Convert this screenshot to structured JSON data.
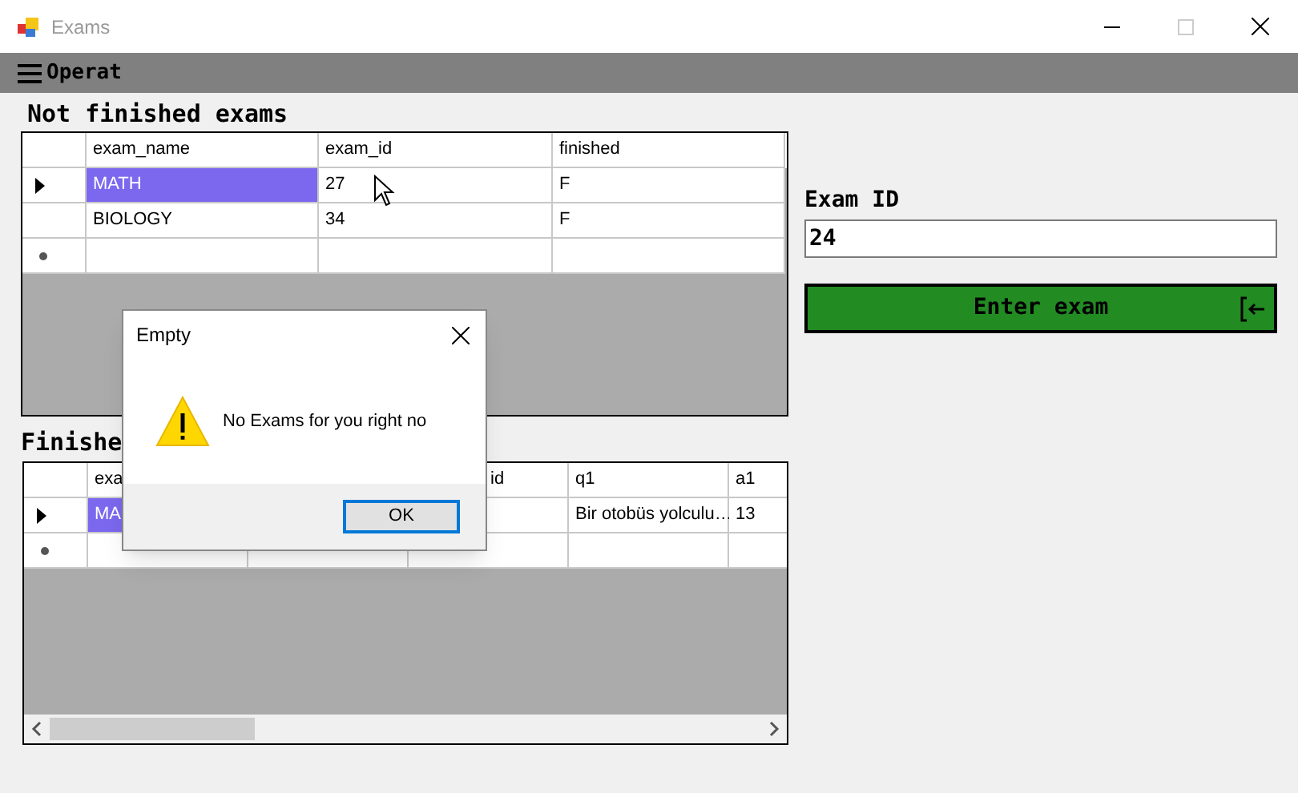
{
  "window": {
    "title": "Exams"
  },
  "menu": [
    {
      "label": "Operat"
    }
  ],
  "not_finished": {
    "title": "Not finished exams",
    "columns": [
      {
        "label": "exam_name"
      },
      {
        "label": "exam_id"
      },
      {
        "label": "finished"
      }
    ],
    "rows": [
      {
        "current": true,
        "cells": [
          {
            "text": "MATH",
            "selected": true
          },
          {
            "text": "27",
            "selected": false
          },
          {
            "text": "F",
            "selected": false
          }
        ]
      },
      {
        "current": false,
        "cells": [
          {
            "text": "BIOLOGY",
            "selected": false
          },
          {
            "text": "34",
            "selected": false
          },
          {
            "text": "F",
            "selected": false
          }
        ]
      }
    ]
  },
  "finished": {
    "title": "Finishe",
    "columns": [
      {
        "label": "exa"
      },
      {},
      {
        "label": "id"
      },
      {
        "label": "q1"
      },
      {
        "label": "a1"
      }
    ],
    "rows": [
      {
        "current": true,
        "cells": [
          {
            "text": "MA",
            "selected": true
          },
          {},
          {
            "selected": false
          },
          {
            "text": "Bir otobüs yolculu…",
            "selected": false
          },
          {
            "text": "13",
            "selected": false
          }
        ]
      }
    ]
  },
  "exam_id": {
    "label": "Exam ID",
    "value": "24"
  },
  "enter_button": {
    "label": "Enter exam"
  },
  "dialog": {
    "title": "Empty",
    "message": "No Exams for you right no",
    "button": "OK"
  }
}
